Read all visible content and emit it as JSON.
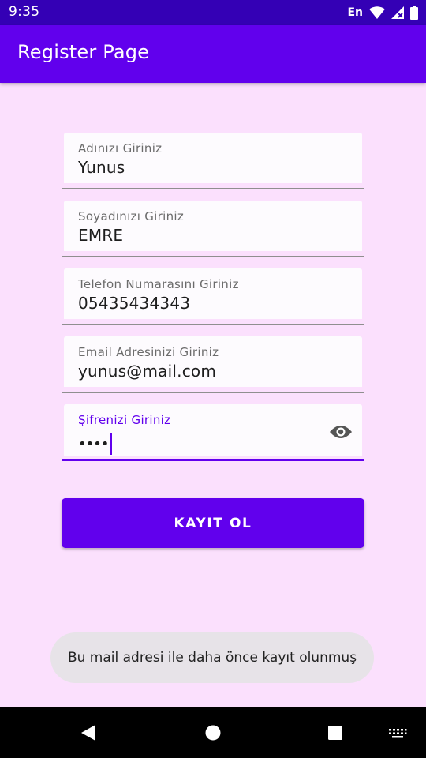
{
  "status_bar": {
    "time": "9:35",
    "language": "En",
    "icons": [
      "wifi-icon",
      "signal-icon",
      "battery-icon"
    ]
  },
  "app_bar": {
    "title": "Register Page"
  },
  "form": {
    "first_name": {
      "label": "Adınızı Giriniz",
      "value": "Yunus"
    },
    "last_name": {
      "label": "Soyadınızı Giriniz",
      "value": "EMRE"
    },
    "phone": {
      "label": "Telefon Numarasını Giriniz",
      "value": "05435434343"
    },
    "email": {
      "label": "Email Adresinizi Giriniz",
      "value": "yunus@mail.com"
    },
    "password": {
      "label": "Şifrenizi Giriniz",
      "masked_value": "••••",
      "toggle_icon": "eye-icon"
    }
  },
  "register_button": {
    "label": "KAYIT OL"
  },
  "toast": {
    "message": "Bu mail adresi ile daha önce kayıt olunmuş"
  },
  "colors": {
    "primary": "#6100ed",
    "primary_dark": "#3400b5",
    "background": "#fbe0fd",
    "toast_background": "#e7e3e8"
  }
}
